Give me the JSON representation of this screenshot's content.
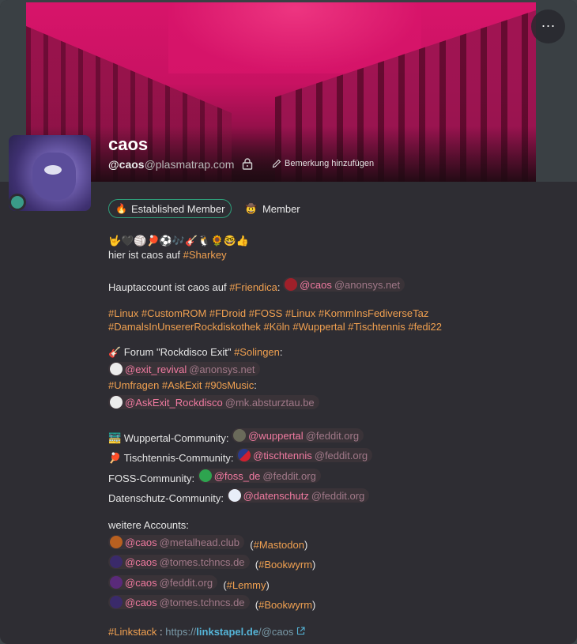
{
  "profile": {
    "name": "caos",
    "handle_user": "@caos",
    "handle_host": "@plasmatrap.com",
    "note_label": "Bemerkung hinzufügen",
    "more_label": "···"
  },
  "badges": {
    "established": "Established Member",
    "established_emoji": "🔥",
    "member": "Member",
    "member_emoji": "🤠"
  },
  "bio": {
    "emoji_line": "🤟🖤🏐🏓⚽🎶🎸🐧🌻🤓👍",
    "line1_text": "hier ist caos auf ",
    "line1_tag": "#Sharkey",
    "main_prefix": "Hauptaccount ist caos auf ",
    "main_tag": "#Friendica",
    "main_sep": ":",
    "main_user": "@caos",
    "main_host": "@anonsys.net",
    "tags_line1": "#Linux #CustomROM #FDroid #FOSS #Linux #KommInsFediverseTaz",
    "tags_line2": "#DamalsInUnsererRockdiskothek #Köln #Wuppertal #Tischtennis #fedi22",
    "forum_emoji": "🎸",
    "forum_text": " Forum \"Rockdisco Exit\" ",
    "forum_tag": "#Solingen",
    "forum_colon": ":",
    "exit_user": "@exit_revival",
    "exit_host": "@anonsys.net",
    "ask_tags": "#Umfragen #AskExit #90sMusic",
    "ask_colon": ":",
    "askexit_user": "@AskExit_Rockdisco",
    "askexit_host": "@mk.absturztau.be",
    "wup_emoji": "🚟",
    "wup_label": " Wuppertal-Community: ",
    "wup_user": "@wuppertal",
    "wup_host": "@feddit.org",
    "tt_emoji": "🏓",
    "tt_label": " Tischtennis-Community: ",
    "tt_user": "@tischtennis",
    "tt_host": "@feddit.org",
    "foss_label": "FOSS-Community: ",
    "foss_user": "@foss_de",
    "foss_host": "@feddit.org",
    "ds_label": "Datenschutz-Community: ",
    "ds_user": "@datenschutz",
    "ds_host": "@feddit.org",
    "more_accounts": "weitere Accounts:",
    "acc1_user": "@caos",
    "acc1_host": "@metalhead.club",
    "acc1_tag": "#Mastodon",
    "acc2_user": "@caos",
    "acc2_host": "@tomes.tchncs.de",
    "acc2_tag": "#Bookwyrm",
    "acc3_user": "@caos",
    "acc3_host": "@feddit.org",
    "acc3_tag": "#Lemmy",
    "acc4_user": "@caos",
    "acc4_host": "@tomes.tchncs.de",
    "acc4_tag": "#Bookwyrm",
    "open_paren": "(",
    "close_paren": ")",
    "linkstack_tag": "#Linkstack",
    "linkstack_sep": " : ",
    "link_pre": "https://",
    "link_host": "linkstapel.de",
    "link_path": "/@caos"
  },
  "colors": {
    "accent_tag": "#f0a050",
    "mention_user": "#f07aa0",
    "link": "#55b5d8",
    "established_border": "#2e9e7a"
  },
  "icons": {
    "lock": "lock-icon",
    "note": "pencil-icon",
    "external": "external-link-icon",
    "more": "more-icon"
  }
}
